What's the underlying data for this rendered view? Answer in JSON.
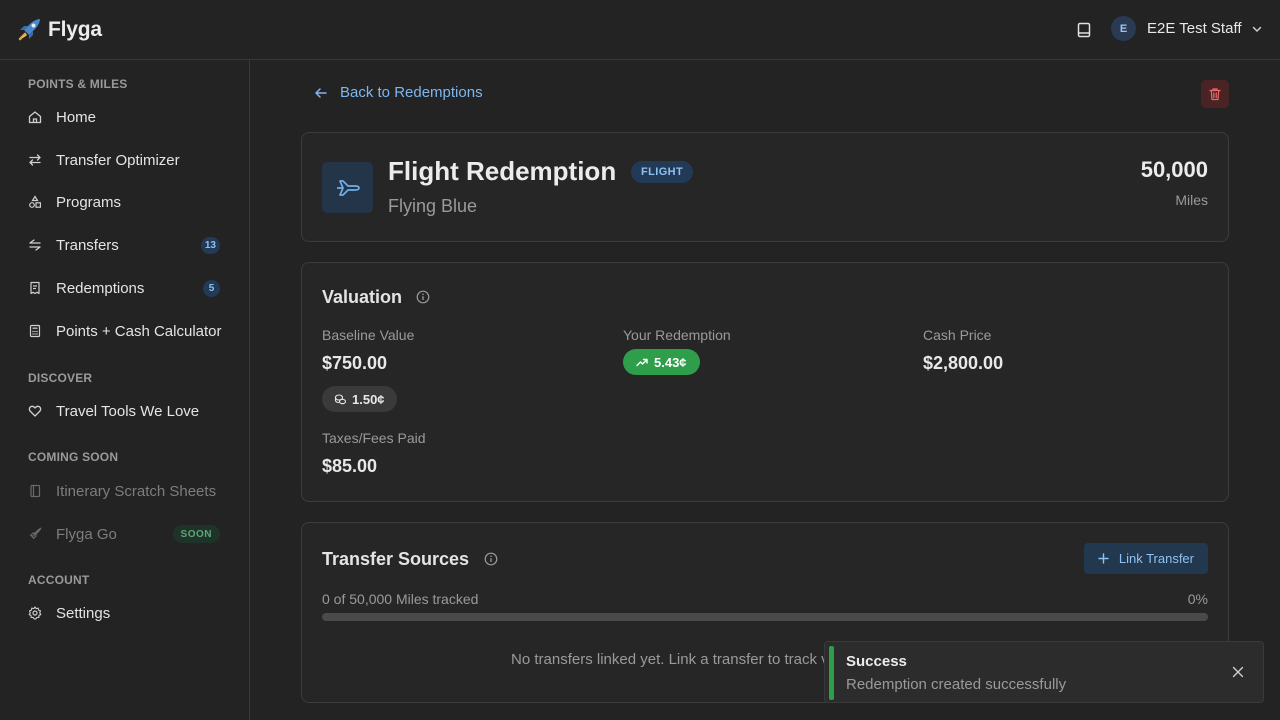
{
  "header": {
    "app_name": "Flyga",
    "user_initial": "E",
    "user_name": "E2E Test Staff"
  },
  "sidebar": {
    "sections": [
      {
        "label": "POINTS & MILES"
      },
      {
        "label": "DISCOVER"
      },
      {
        "label": "COMING SOON"
      },
      {
        "label": "ACCOUNT"
      }
    ],
    "items": [
      {
        "label": "Home",
        "icon": "home-icon"
      },
      {
        "label": "Transfer Optimizer",
        "icon": "arrows-icon"
      },
      {
        "label": "Programs",
        "icon": "shapes-icon"
      },
      {
        "label": "Transfers",
        "icon": "transfer-icon",
        "badge": "13"
      },
      {
        "label": "Redemptions",
        "icon": "receipt-icon",
        "badge": "5"
      },
      {
        "label": "Points + Cash Calculator",
        "icon": "calculator-icon"
      },
      {
        "label": "Travel Tools We Love",
        "icon": "heart-icon"
      },
      {
        "label": "Itinerary Scratch Sheets",
        "icon": "notebook-icon"
      },
      {
        "label": "Flyga Go",
        "icon": "rocket-icon",
        "tag": "SOON"
      },
      {
        "label": "Settings",
        "icon": "gear-icon"
      }
    ]
  },
  "main": {
    "back_label": "Back to Redemptions",
    "redemption": {
      "title": "Flight Redemption",
      "type_badge": "FLIGHT",
      "program": "Flying Blue",
      "amount": "50,000",
      "unit": "Miles"
    },
    "valuation": {
      "title": "Valuation",
      "baseline_label": "Baseline Value",
      "baseline_value": "$750.00",
      "baseline_rate": "1.50¢",
      "your_label": "Your Redemption",
      "your_rate": "5.43¢",
      "cash_label": "Cash Price",
      "cash_value": "$2,800.00",
      "taxes_label": "Taxes/Fees Paid",
      "taxes_value": "$85.00"
    },
    "transfer_sources": {
      "title": "Transfer Sources",
      "link_label": "Link Transfer",
      "tracked_text": "0 of 50,000 Miles tracked",
      "percent_text": "0%",
      "progress": 0,
      "empty_text": "No transfers linked yet. Link a transfer to track v"
    }
  },
  "toast": {
    "title": "Success",
    "message": "Redemption created successfully"
  },
  "colors": {
    "accent": "#7db7ee",
    "success": "#2f9e4a",
    "danger": "#4a2424"
  }
}
